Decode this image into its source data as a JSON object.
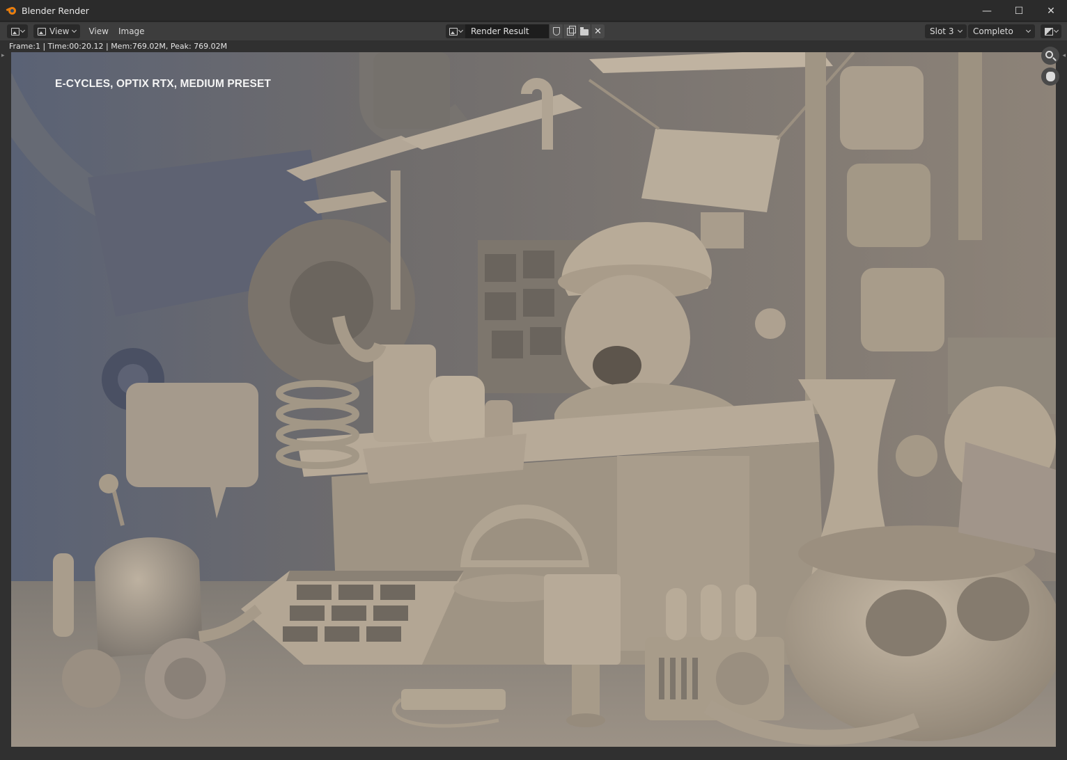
{
  "window": {
    "title": "Blender Render",
    "controls": {
      "minimize": "—",
      "maximize": "☐",
      "close": "✕"
    }
  },
  "header": {
    "menus": [
      "View",
      "View",
      "Image"
    ],
    "image_name": "Render Result",
    "slot": "Slot 3",
    "pass": "Completo"
  },
  "status": {
    "text": "Frame:1 | Time:00:20.12 | Mem:769.02M, Peak: 769.02M"
  },
  "render": {
    "overlay_label": "E-CYCLES, OPTIX RTX, MEDIUM PRESET",
    "palette": {
      "shadow": "#4e5568",
      "mid": "#8a8279",
      "light": "#b4a898",
      "highlight": "#cbbfae"
    }
  },
  "icons": [
    "blender-logo-icon",
    "image-editor-icon",
    "shield-icon",
    "duplicate-icon",
    "folder-icon",
    "close-icon",
    "zoom-icon",
    "hand-icon"
  ]
}
